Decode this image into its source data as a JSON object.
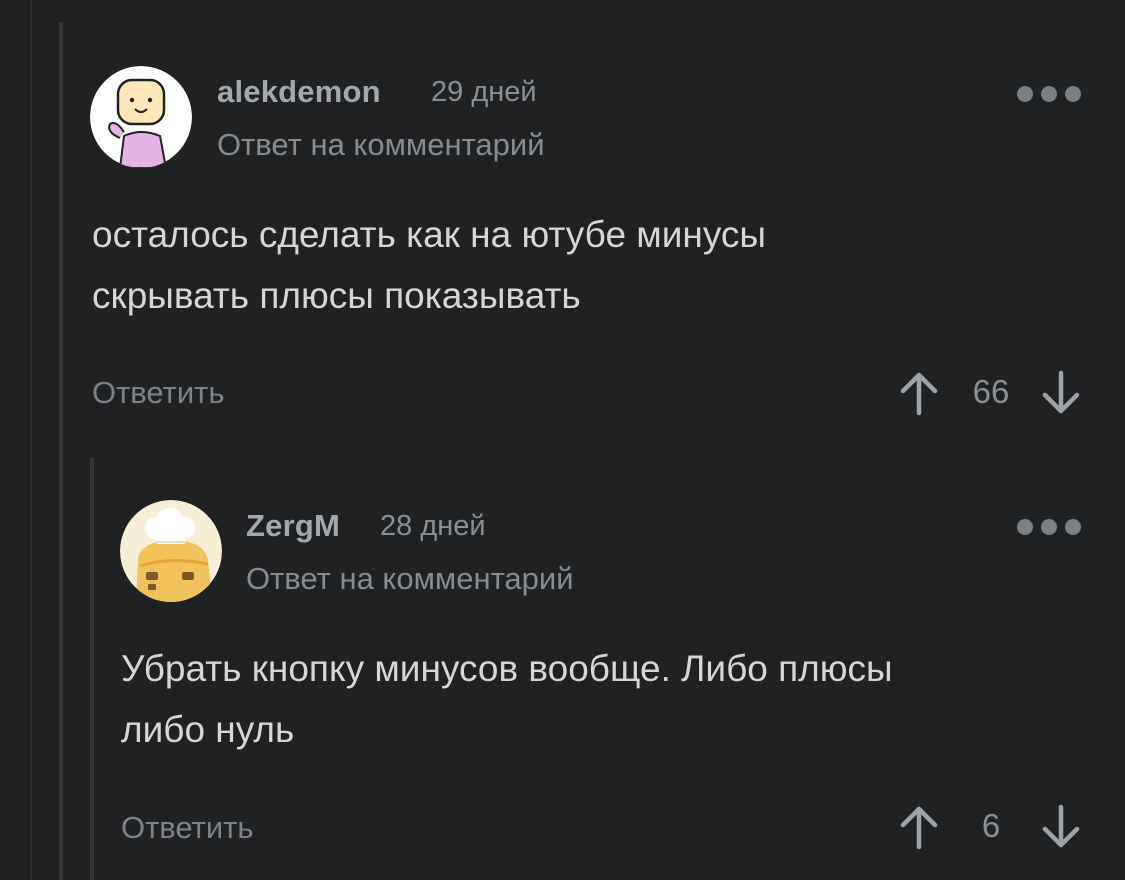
{
  "comments": [
    {
      "author": "alekdemon",
      "time": "29 дней",
      "subtitle": "Ответ на комментарий",
      "body_lines": [
        "осталось сделать как на ютубе минусы",
        "скрывать плюсы показывать"
      ],
      "reply_label": "Ответить",
      "score": "66",
      "avatar": "avatar-cartoon-person-pink-shirt"
    },
    {
      "author": "ZergM",
      "time": "28 дней",
      "subtitle": "Ответ на комментарий",
      "body_lines": [
        "Убрать кнопку минусов вообще. Либо плюсы",
        "либо нуль"
      ],
      "reply_label": "Ответить",
      "score": "6",
      "avatar": "avatar-cartoon-chef-hat"
    }
  ],
  "icons": {
    "more": "more-dots-icon",
    "upvote": "arrow-up-icon",
    "downvote": "arrow-down-icon"
  },
  "colors": {
    "background": "#1f2123",
    "thread_line": "#34373a",
    "text": "#d4d6d8",
    "muted": "#878c91"
  }
}
